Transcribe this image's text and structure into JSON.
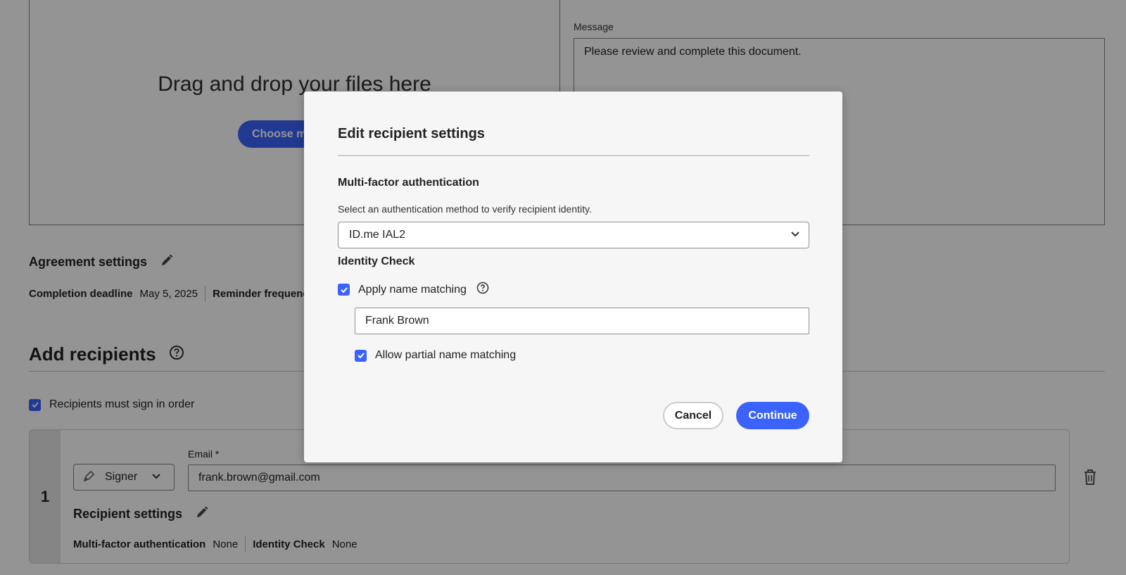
{
  "background": {
    "dropzone": {
      "title": "Drag and drop your files here",
      "choose_label": "Choose mo"
    },
    "message": {
      "label": "Message",
      "value": "Please review and complete this document."
    },
    "agreement": {
      "title": "Agreement settings",
      "deadline_label": "Completion deadline",
      "deadline_value": "May 5, 2025",
      "reminder_label": "Reminder frequenc"
    },
    "recipients": {
      "title": "Add recipients",
      "sign_in_order_label": "Recipients must sign in order",
      "sign_in_order_checked": true,
      "items": [
        {
          "number": "1",
          "role": "Signer",
          "email_label": "Email",
          "required_mark": "*",
          "email": "frank.brown@gmail.com",
          "settings_title": "Recipient settings",
          "mfa_label": "Multi-factor authentication",
          "mfa_value": "None",
          "idcheck_label": "Identity Check",
          "idcheck_value": "None"
        }
      ]
    }
  },
  "modal": {
    "title": "Edit recipient settings",
    "mfa_heading": "Multi-factor authentication",
    "mfa_description": "Select an authentication method to verify recipient identity.",
    "mfa_selected": "ID.me IAL2",
    "identity_heading": "Identity Check",
    "apply_name_matching_label": "Apply name matching",
    "apply_name_matching_checked": true,
    "name_value": "Frank Brown",
    "allow_partial_label": "Allow partial name matching",
    "allow_partial_checked": true,
    "cancel_label": "Cancel",
    "continue_label": "Continue"
  },
  "colors": {
    "accent": "#3b63fb",
    "overlay": "rgba(0,0,0,0.42)",
    "modal_bg": "#f6f6f6"
  }
}
